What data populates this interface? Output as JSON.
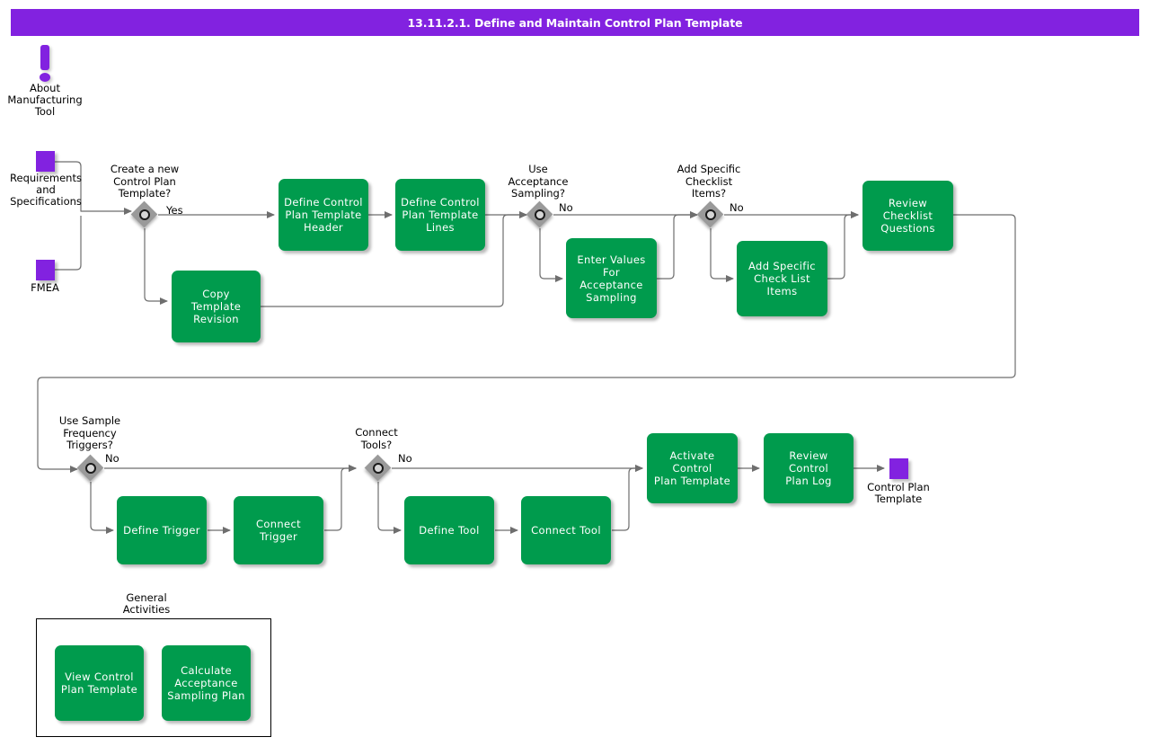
{
  "header": {
    "title": "13.11.2.1. Define and Maintain Control Plan Template",
    "bar_color": "#8222e0",
    "text_color": "#ffffff"
  },
  "palette": {
    "activity_green": "#009b4d",
    "data_purple": "#8222e0",
    "gateway_gray": "#9a9a9a",
    "connector_gray": "#6e6e6e",
    "text_dark": "#000000",
    "activity_text": "#ffffff"
  },
  "info": {
    "icon": "exclamation-icon",
    "label": "About\nManufacturing\nTool",
    "label_lines": [
      "About",
      "Manufacturing",
      "Tool"
    ]
  },
  "inputs": [
    {
      "id": "requirements",
      "label_lines": [
        "Requirements",
        "and",
        "Specifications"
      ],
      "label": "Requirements and Specifications"
    },
    {
      "id": "fmea",
      "label_lines": [
        "FMEA"
      ],
      "label": "FMEA"
    }
  ],
  "outputs": [
    {
      "id": "control-plan-template",
      "label_lines": [
        "Control Plan",
        "Template"
      ],
      "label": "Control Plan Template"
    }
  ],
  "gateways": [
    {
      "id": "create-new-control-plan-template",
      "question_lines": [
        "Create a new",
        "Control Plan",
        "Template?"
      ],
      "question": "Create a new Control Plan Template?",
      "branch": "Yes"
    },
    {
      "id": "use-acceptance-sampling",
      "question_lines": [
        "Use",
        "Acceptance",
        "Sampling?"
      ],
      "question": "Use Acceptance Sampling?",
      "branch": "No"
    },
    {
      "id": "add-specific-checklist-items",
      "question_lines": [
        "Add Specific",
        "Checklist",
        "Items?"
      ],
      "question": "Add Specific Checklist Items?",
      "branch": "No"
    },
    {
      "id": "use-sample-frequency-triggers",
      "question_lines": [
        "Use Sample",
        "Frequency",
        "Triggers?"
      ],
      "question": "Use Sample Frequency Triggers?",
      "branch": "No"
    },
    {
      "id": "connect-tools",
      "question_lines": [
        "Connect",
        "Tools?"
      ],
      "question": "Connect Tools?",
      "branch": "No"
    }
  ],
  "activities": [
    {
      "id": "copy-template-revision",
      "label": "Copy Template\nRevision"
    },
    {
      "id": "define-control-plan-template-header",
      "label": "Define Control\nPlan Template\nHeader"
    },
    {
      "id": "define-control-plan-template-lines",
      "label": "Define Control\nPlan Template\nLines"
    },
    {
      "id": "enter-values-for-acceptance-sampling",
      "label": "Enter Values For\nAcceptance\nSampling"
    },
    {
      "id": "add-specific-check-list-items",
      "label": "Add Specific\nCheck List\nItems"
    },
    {
      "id": "review-checklist-questions",
      "label": "Review\nChecklist\nQuestions"
    },
    {
      "id": "define-trigger",
      "label": "Define Trigger"
    },
    {
      "id": "connect-trigger",
      "label": "Connect Trigger"
    },
    {
      "id": "define-tool",
      "label": "Define Tool"
    },
    {
      "id": "connect-tool",
      "label": "Connect Tool"
    },
    {
      "id": "activate-control-plan-template",
      "label": "Activate Control\nPlan Template"
    },
    {
      "id": "review-control-plan-log",
      "label": "Review Control\nPlan Log"
    }
  ],
  "general_activities": {
    "title_lines": [
      "General",
      "Activities"
    ],
    "title": "General Activities",
    "items": [
      {
        "id": "view-control-plan-template",
        "label": "View Control\nPlan Template"
      },
      {
        "id": "calculate-acceptance-sampling-plan",
        "label": "Calculate\nAcceptance\nSampling Plan"
      }
    ]
  }
}
